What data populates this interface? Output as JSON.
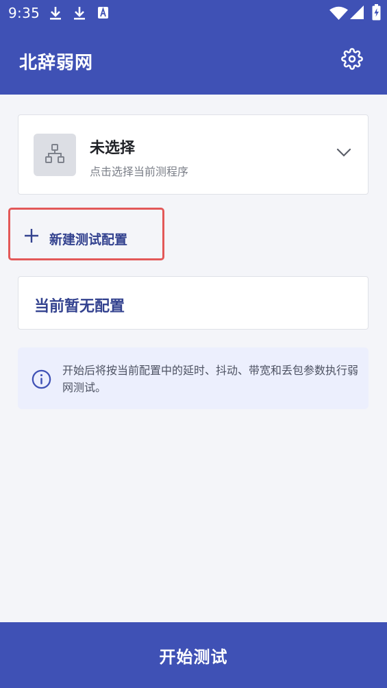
{
  "status_bar": {
    "time": "9:35",
    "icons": [
      "download-icon",
      "download-icon",
      "app-notification-icon",
      "wifi-icon",
      "signal-icon",
      "battery-icon"
    ]
  },
  "app_bar": {
    "title": "北辞弱网",
    "settings_icon": "gear-icon"
  },
  "program_selector": {
    "icon": "network-tree-icon",
    "title": "未选择",
    "subtitle": "点击选择当前测程序",
    "chevron_icon": "chevron-down-icon"
  },
  "new_config": {
    "icon": "plus-icon",
    "label": "新建测试配置"
  },
  "config_list": {
    "empty_text": "当前暂无配置"
  },
  "info": {
    "icon": "info-icon",
    "text": "开始后将按当前配置中的延时、抖动、带宽和丢包参数执行弱网测试。"
  },
  "start_button": {
    "label": "开始测试"
  },
  "colors": {
    "primary": "#3f51b5",
    "highlight_border": "#e35858",
    "accent_text": "#33428f",
    "background": "#f4f5f9",
    "info_background": "#eceffd"
  }
}
